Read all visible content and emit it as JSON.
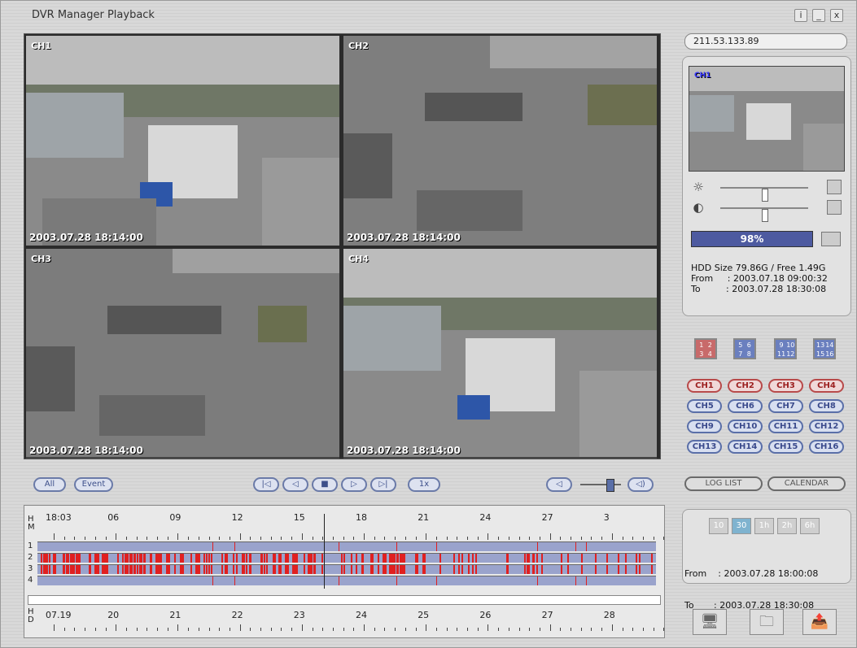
{
  "window": {
    "title": "DVR Manager Playback",
    "buttons": [
      "i",
      "_",
      "x"
    ]
  },
  "server_ip": "211.53.133.89",
  "cameras": [
    {
      "label": "CH1",
      "timestamp": "2003.07.28 18:14:00"
    },
    {
      "label": "CH2",
      "timestamp": "2003.07.28 18:14:00"
    },
    {
      "label": "CH3",
      "timestamp": "2003.07.28 18:14:00"
    },
    {
      "label": "CH4",
      "timestamp": "2003.07.28 18:14:00"
    }
  ],
  "preview": {
    "label": "CH1"
  },
  "controls": {
    "brightness_icon": "sun-icon",
    "contrast_icon": "contrast-icon",
    "brightness_level": 0.5,
    "contrast_level": 0.5
  },
  "progress": {
    "value": "98%"
  },
  "hdd": {
    "size": "HDD Size 79.86G / Free 1.49G",
    "from": "From     : 2003.07.18 09:00:32",
    "to": "To         : 2003.07.28 18:30:08"
  },
  "split_buttons": [
    [
      "1",
      "2",
      "3",
      "4"
    ],
    [
      "5",
      "6",
      "7",
      "8"
    ],
    [
      "9",
      "10",
      "11",
      "12"
    ],
    [
      "13",
      "14",
      "15",
      "16"
    ]
  ],
  "channel_buttons": [
    "CH1",
    "CH2",
    "CH3",
    "CH4",
    "CH5",
    "CH6",
    "CH7",
    "CH8",
    "CH9",
    "CH10",
    "CH11",
    "CH12",
    "CH13",
    "CH14",
    "CH15",
    "CH16"
  ],
  "playback": {
    "all": "All",
    "event": "Event",
    "buttons": [
      "|◁",
      "◁",
      "■",
      "▷",
      "▷|",
      "1x"
    ],
    "volume_down": "◁",
    "volume_up": "◁)"
  },
  "list_buttons": {
    "log": "LOG LIST",
    "calendar": "CALENDAR"
  },
  "zoom": [
    "10",
    "30",
    "1h",
    "2h",
    "6h"
  ],
  "range": {
    "from": "From    : 2003.07.28 18:00:08",
    "to": "To       : 2003.07.28 18:30:08"
  },
  "timeline": {
    "hm_label_top": "H\nM",
    "minute_labels": [
      "18:03",
      "06",
      "09",
      "12",
      "15",
      "18",
      "21",
      "24",
      "27",
      "3"
    ],
    "rows": [
      "1",
      "2",
      "3",
      "4"
    ],
    "hd_label": "H\nD",
    "day_labels": [
      "07.19",
      "20",
      "21",
      "22",
      "23",
      "24",
      "25",
      "26",
      "27",
      "28"
    ]
  },
  "colors": {
    "accent_blue": "#4d5aa0",
    "event_red": "#e02020",
    "track_blue": "#9aa3cc"
  }
}
